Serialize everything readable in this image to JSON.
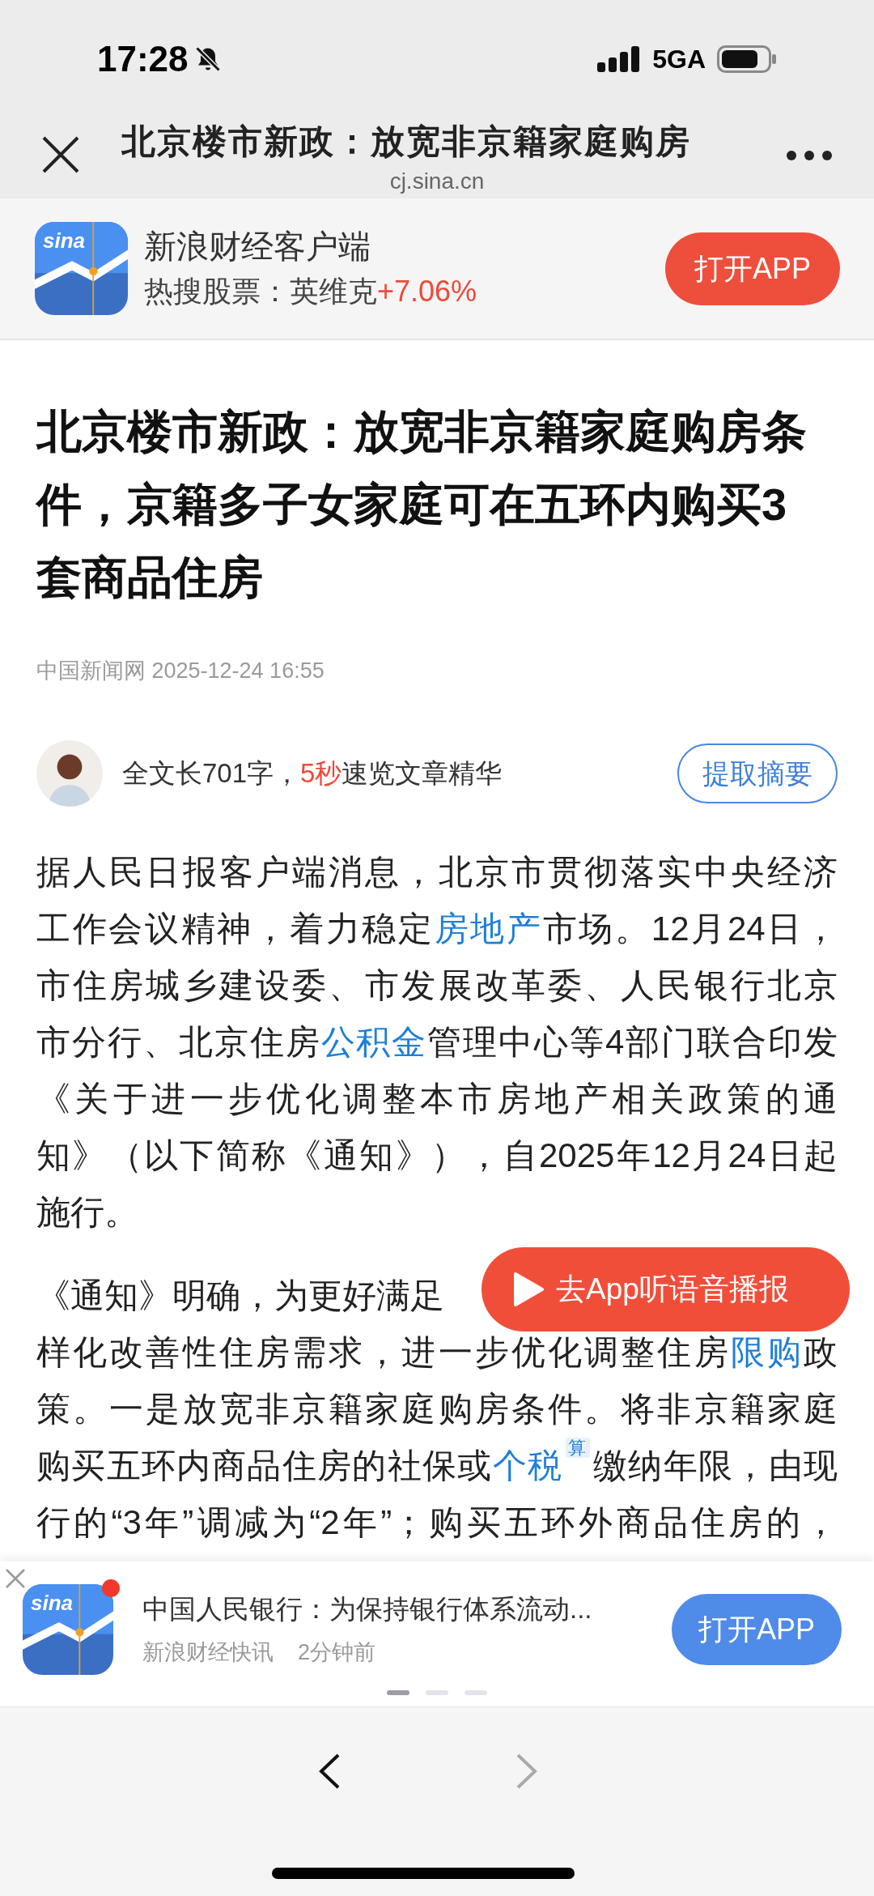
{
  "status_bar": {
    "time": "17:28",
    "network": "5GA"
  },
  "nav_bar": {
    "title": "北京楼市新政：放宽非京籍家庭购房",
    "url": "cj.sina.cn"
  },
  "app_banner": {
    "logo_text": "sina",
    "name": "新浪财经客户端",
    "hot_label": "热搜股票：英维克",
    "hot_change": "+7.06%",
    "button": "打开APP"
  },
  "article": {
    "title": "北京楼市新政：放宽非京籍家庭购房条件，京籍多子女家庭可在五环内购买3套商品住房",
    "source": "中国新闻网 2025-12-24 16:55",
    "summary": {
      "segments": [
        {
          "text": "全文长701字，",
          "kind": "plain"
        },
        {
          "text": "5秒",
          "kind": "highlight"
        },
        {
          "text": "速览文章精华",
          "kind": "plain"
        }
      ],
      "button": "提取摘要"
    },
    "paragraphs": [
      [
        {
          "kind": "full",
          "segments": [
            {
              "text": "据人民日报客户端消息，北京市贯彻落实中央经济",
              "kind": "plain"
            }
          ]
        },
        {
          "kind": "full",
          "segments": [
            {
              "text": "工作会议精神，着力稳定",
              "kind": "plain"
            },
            {
              "text": "房地产",
              "kind": "link"
            },
            {
              "text": "市场。12月24日，",
              "kind": "plain"
            }
          ]
        },
        {
          "kind": "full",
          "segments": [
            {
              "text": "市住房城乡建设委、市发展改革委、人民银行北京",
              "kind": "plain"
            }
          ]
        },
        {
          "kind": "full",
          "segments": [
            {
              "text": "市分行、北京住房",
              "kind": "plain"
            },
            {
              "text": "公积金",
              "kind": "link"
            },
            {
              "text": "管理中心等4部门联合印发",
              "kind": "plain"
            }
          ]
        },
        {
          "kind": "full",
          "segments": [
            {
              "text": "《关于进一步优化调整本市房地产相关政策的通",
              "kind": "plain"
            }
          ]
        },
        {
          "kind": "full",
          "segments": [
            {
              "text": "知》（以下简称《通知》），自2025年12月24日起",
              "kind": "plain"
            }
          ]
        },
        {
          "kind": "end",
          "segments": [
            {
              "text": "施行。",
              "kind": "plain"
            }
          ]
        }
      ],
      [
        {
          "kind": "end",
          "segments": [
            {
              "text": "《通知》明确，为更好满足",
              "kind": "plain"
            }
          ]
        },
        {
          "kind": "full",
          "segments": [
            {
              "text": "样化改善性住房需求，进一步优化调整住房",
              "kind": "plain"
            },
            {
              "text": "限购",
              "kind": "link"
            },
            {
              "text": "政",
              "kind": "plain"
            }
          ]
        },
        {
          "kind": "full",
          "segments": [
            {
              "text": "策。一是放宽非京籍家庭购房条件。将非京籍家庭",
              "kind": "plain"
            }
          ]
        },
        {
          "kind": "full",
          "segments": [
            {
              "text": "购买五环内商品住房的社保或",
              "kind": "plain"
            },
            {
              "text": "个税",
              "kind": "link"
            },
            {
              "text": "算",
              "kind": "badge"
            },
            {
              "text": "缴纳年限，由现",
              "kind": "plain"
            }
          ]
        },
        {
          "kind": "full",
          "segments": [
            {
              "text": "行的“3年”调减为“2年”；购买五环外商品住房的，",
              "kind": "plain"
            }
          ]
        }
      ]
    ],
    "audio_button": "去App听语音播报"
  },
  "bottom_banner": {
    "logo_text": "sina",
    "title": "中国人民银行：为保持银行体系流动...",
    "source": "新浪财经快讯",
    "time": "2分钟前",
    "button": "打开APP",
    "pages": [
      {
        "selected": true
      },
      {
        "selected": false
      },
      {
        "selected": false
      }
    ]
  }
}
